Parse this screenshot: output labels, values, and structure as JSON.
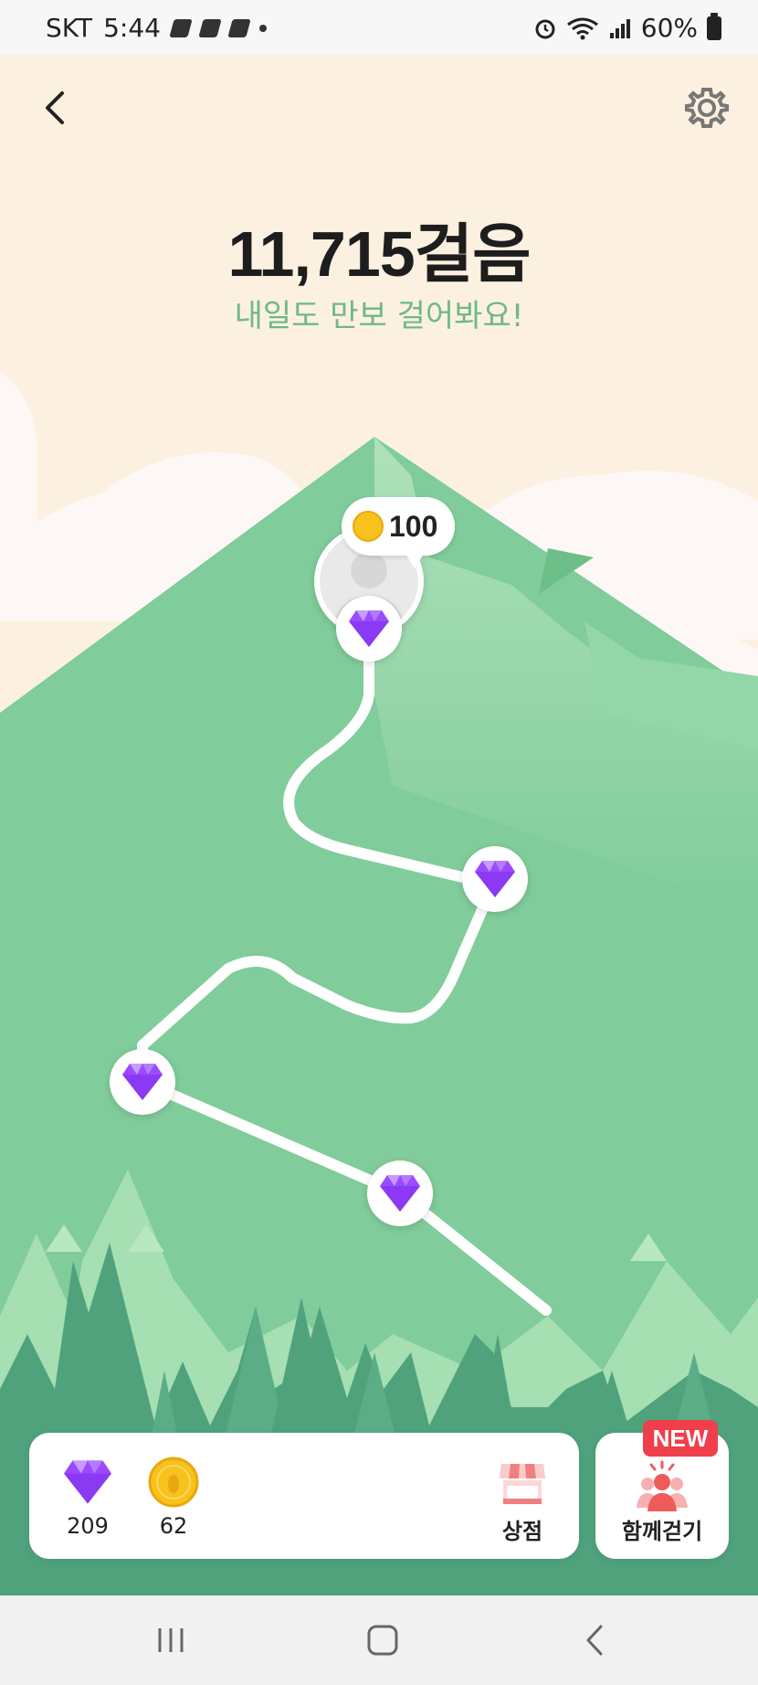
{
  "status_bar": {
    "carrier": "SKT",
    "time": "5:44",
    "battery": "60%"
  },
  "header": {
    "back_icon": "chevron-left-icon",
    "settings_icon": "gear-icon"
  },
  "summary": {
    "steps": "11,715걸음",
    "message": "내일도 만보 걸어봐요!"
  },
  "summit": {
    "reward": "100",
    "reward_icon": "coin-icon"
  },
  "path": {
    "nodes": [
      "gem",
      "gem",
      "gem",
      "gem"
    ],
    "gem_icon": "diamond-icon"
  },
  "bottom": {
    "gems": "209",
    "coins": "62",
    "shop_label": "상점",
    "walk_together_label": "함께걷기",
    "new_badge": "NEW"
  },
  "colors": {
    "sky": "#fcf1e1",
    "mountain": "#80cc9a",
    "accent_text": "#6fb985",
    "gem": "#9a4bff",
    "badge": "#ef3f4a"
  }
}
